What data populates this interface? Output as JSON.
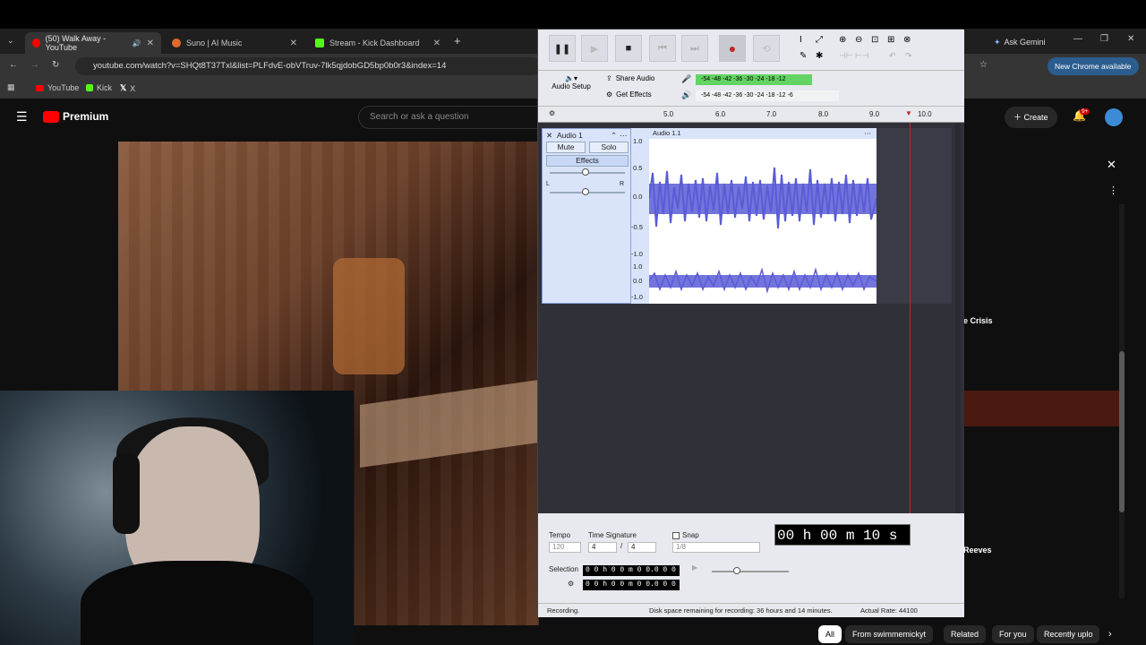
{
  "browser": {
    "tabs": [
      {
        "label": "(50) Walk Away - YouTube"
      },
      {
        "label": "Suno | AI Music"
      },
      {
        "label": "Stream - Kick Dashboard"
      }
    ],
    "url": "youtube.com/watch?v=SHQt8T37Txl&list=PLFdvE-obVTruv-7lk5qjdobGD5bp0b0r3&index=14",
    "bookmarks": [
      "YouTube",
      "Kick",
      "X"
    ],
    "ask_gemini": "Ask Gemini",
    "update_notice": "New Chrome available"
  },
  "youtube": {
    "brand": "Premium",
    "search_placeholder": "Search or ask a question",
    "create": "Create",
    "notif_count": "9+",
    "sidebar_text_1": "e Crisis",
    "sidebar_text_2": "Reeves",
    "chips": [
      "All",
      "From swimmemickyt",
      "Related",
      "For you",
      "Recently uplo"
    ]
  },
  "audacity": {
    "audio_setup": "Audio Setup",
    "share_audio": "Share Audio",
    "get_effects": "Get Effects",
    "meter_rec_ticks": "-54  -48  -42  -36  -30  -24  -18  -12",
    "meter_play_ticks": "-54  -48  -42  -36  -30  -24  -18  -12  -6",
    "ruler": [
      "5.0",
      "6.0",
      "7.0",
      "8.0",
      "9.0",
      "10.0"
    ],
    "track_name": "Audio 1",
    "clip_name": "Audio 1.1",
    "mute": "Mute",
    "solo": "Solo",
    "effects": "Effects",
    "pan_l": "L",
    "pan_r": "R",
    "scale_top": [
      "1.0",
      "0.5",
      "0.0",
      "-0.5",
      "-1.0"
    ],
    "scale_bottom": [
      "1.0",
      "0.0",
      "-1.0"
    ],
    "tempo_label": "Tempo",
    "tempo_value": "120",
    "timesig_label": "Time Signature",
    "timesig_num": "4",
    "timesig_den": "4",
    "snap_label": "Snap",
    "snap_value": "1/8",
    "time_display": "00 h 00 m 10 s",
    "selection_label": "Selection",
    "sel_start": "0 0 h 0 0 m 0 0.0 0 0 s",
    "sel_end": "0 0 h 0 0 m 0 0.0 0 0 s",
    "status_left": "Recording.",
    "status_mid": "Disk space remaining for recording: 36 hours and 14 minutes.",
    "status_right": "Actual Rate: 44100"
  }
}
